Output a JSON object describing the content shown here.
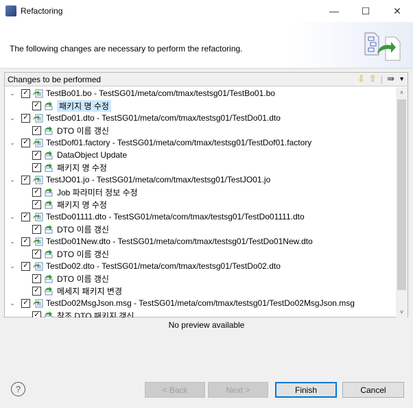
{
  "window": {
    "title": "Refactoring"
  },
  "header": {
    "message": "The following changes are necessary to perform the refactoring."
  },
  "panel": {
    "title": "Changes to be performed"
  },
  "tree": [
    {
      "label": "TestBo01.bo - TestSG01/meta/com/tmax/testsg01/TestBo01.bo",
      "children": [
        {
          "label": "패키지 명 수정",
          "selected": true
        }
      ]
    },
    {
      "label": "TestDo01.dto - TestSG01/meta/com/tmax/testsg01/TestDo01.dto",
      "children": [
        {
          "label": "DTO 이름 갱신"
        }
      ]
    },
    {
      "label": "TestDof01.factory - TestSG01/meta/com/tmax/testsg01/TestDof01.factory",
      "children": [
        {
          "label": "DataObject Update"
        },
        {
          "label": "패키지 명 수정"
        }
      ]
    },
    {
      "label": "TestJO01.jo - TestSG01/meta/com/tmax/testsg01/TestJO01.jo",
      "children": [
        {
          "label": "Job 파라미터 정보 수정"
        },
        {
          "label": "패키지 명 수정"
        }
      ]
    },
    {
      "label": "TestDo01111.dto - TestSG01/meta/com/tmax/testsg01/TestDo01111.dto",
      "children": [
        {
          "label": "DTO 이름 갱신"
        }
      ]
    },
    {
      "label": "TestDo01New.dto - TestSG01/meta/com/tmax/testsg01/TestDo01New.dto",
      "children": [
        {
          "label": "DTO 이름 갱신"
        }
      ]
    },
    {
      "label": "TestDo02.dto - TestSG01/meta/com/tmax/testsg01/TestDo02.dto",
      "children": [
        {
          "label": "DTO 이름 갱신"
        },
        {
          "label": "메세지 패키지 변경"
        }
      ]
    },
    {
      "label": "TestDo02MsgJson.msg - TestSG01/meta/com/tmax/testsg01/TestDo02MsgJson.msg",
      "children": [
        {
          "label": "참조 DTO 패키지 갱신"
        }
      ]
    }
  ],
  "preview": {
    "text": "No preview available"
  },
  "buttons": {
    "back": "< Back",
    "next": "Next >",
    "finish": "Finish",
    "cancel": "Cancel",
    "help": "?"
  }
}
